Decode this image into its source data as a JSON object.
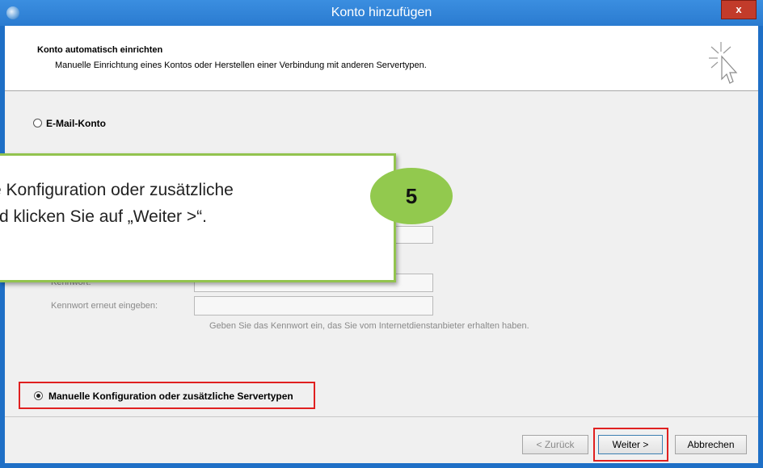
{
  "window": {
    "title": "Konto hinzufügen",
    "close_label": "x"
  },
  "header": {
    "title": "Konto automatisch einrichten",
    "subtitle": "Manuelle Einrichtung eines Kontos oder Herstellen einer Verbindung mit anderen Servertypen."
  },
  "options": {
    "email_account": {
      "label": "E-Mail-Konto",
      "selected": false
    },
    "manual_config": {
      "label": "Manuelle Konfiguration oder zusätzliche Servertypen",
      "selected": true
    }
  },
  "form": {
    "password_label": "Kennwort:",
    "password_confirm_label": "Kennwort erneut eingeben:",
    "hint": "Geben Sie das Kennwort ein, das Sie vom Internetdienstanbieter erhalten haben."
  },
  "buttons": {
    "back": "< Zurück",
    "next": "Weiter >",
    "cancel": "Abbrechen"
  },
  "callout": {
    "line1": "e Konfiguration oder zusätzliche",
    "line2": "d klicken Sie auf „Weiter >“.",
    "step_number": "5"
  },
  "colors": {
    "titlebar": "#2a7bd0",
    "callout_border": "#92c34e",
    "badge": "#92c94e",
    "highlight": "#e02020"
  },
  "icons": {
    "app": "outlook-globe-icon",
    "header": "cursor-sparkle-icon"
  }
}
